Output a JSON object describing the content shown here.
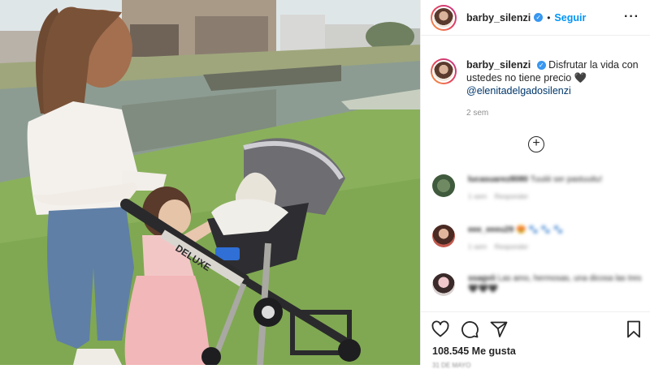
{
  "post": {
    "author": "barby_silenzi",
    "separator": "•",
    "follow_label": "Seguir",
    "more_label": "···",
    "caption_text": "Disfrutar la vida con ustedes no tiene precio 🖤",
    "caption_mention": "@elenitadelgadosilenzi",
    "time_ago": "2 sem",
    "load_more_label": "+",
    "likes_label": "108.545 Me gusta",
    "date_label": "31 DE MAYO"
  },
  "photo": {
    "stroller_brand": "DELUXE"
  },
  "comments": [
    {
      "user": "lucasuarez8080",
      "text": "Tuuiiii ser pastuuitu!",
      "likes_meta": "1 sem",
      "reply": "Responder"
    },
    {
      "user": "eee_eeeu29",
      "text": "😍 🐾 🐾 🐾",
      "likes_meta": "1 sem",
      "reply": "Responder"
    },
    {
      "user": "ssagvii",
      "text": "Las amo, hermosas, una dicosa las tres",
      "text2": "🖤🖤🖤",
      "likes_meta": "1 sem",
      "reply": "Responder"
    }
  ],
  "colors": {
    "accent": "#0095f6",
    "verified": "#3897f0",
    "mention": "#00376b",
    "muted": "#8e8e8e"
  },
  "icons": {
    "like": "heart-icon",
    "comment": "comment-bubble-icon",
    "share": "paper-plane-icon",
    "save": "bookmark-icon"
  }
}
